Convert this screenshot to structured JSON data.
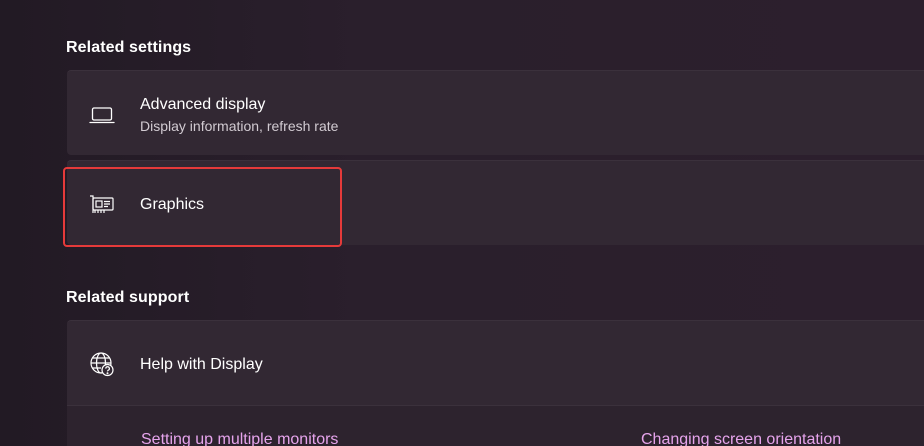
{
  "related_settings": {
    "heading": "Related settings",
    "advanced_display": {
      "title": "Advanced display",
      "subtitle": "Display information, refresh rate",
      "icon": "laptop-icon"
    },
    "graphics": {
      "title": "Graphics",
      "icon": "graphics-card-icon",
      "highlighted": true
    }
  },
  "related_support": {
    "heading": "Related support",
    "help": {
      "title": "Help with Display",
      "icon": "globe-help-icon"
    },
    "links": [
      {
        "label": "Setting up multiple monitors"
      },
      {
        "label": "Changing screen orientation"
      }
    ]
  },
  "colors": {
    "highlight_border": "#e53a3a",
    "link": "#e6a4ec",
    "card_background": "#322833"
  }
}
